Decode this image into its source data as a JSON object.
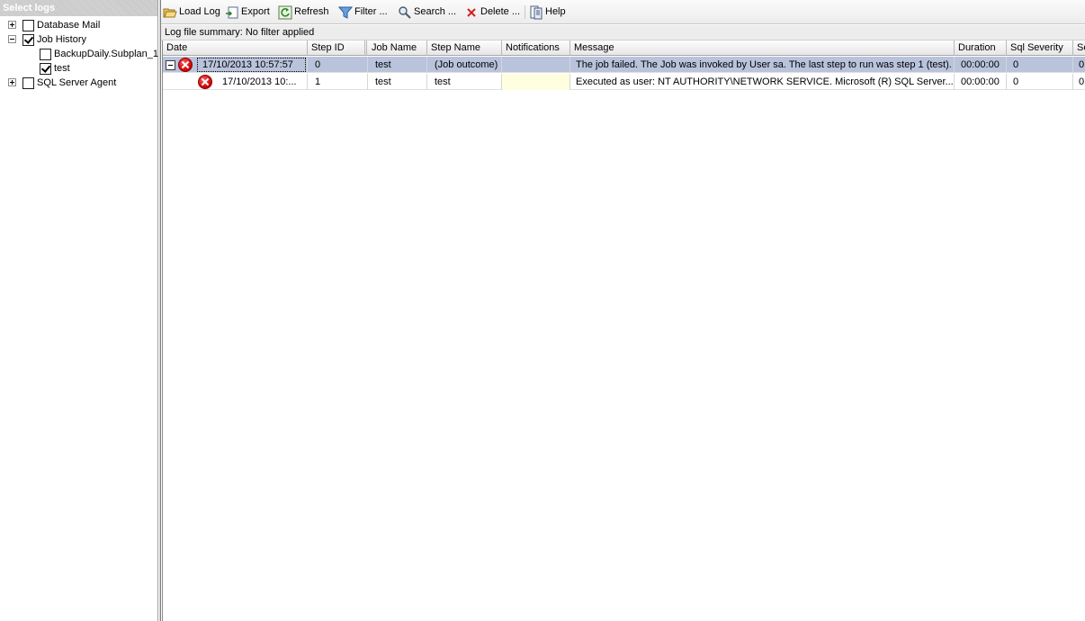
{
  "left_pane": {
    "title": "Select logs",
    "tree": [
      {
        "label": "Database Mail",
        "expanded": false,
        "checked": false,
        "level": 0
      },
      {
        "label": "Job History",
        "expanded": true,
        "checked": true,
        "level": 0
      },
      {
        "label": "BackupDaily.Subplan_1",
        "checked": false,
        "level": 1
      },
      {
        "label": "test",
        "checked": true,
        "level": 1
      },
      {
        "label": "SQL Server Agent",
        "expanded": false,
        "checked": false,
        "level": 0
      }
    ]
  },
  "toolbar": {
    "load_log": "Load Log",
    "export": "Export",
    "refresh": "Refresh",
    "filter": "Filter ...",
    "search": "Search ...",
    "delete": "Delete ...",
    "help": "Help"
  },
  "summary": "Log file summary: No filter applied",
  "grid": {
    "columns": [
      "Date",
      "Step ID",
      "Job Name",
      "Step Name",
      "Notifications",
      "Message",
      "Duration",
      "Sql Severity",
      "Se"
    ],
    "rows": [
      {
        "expanded": true,
        "selected": true,
        "status": "error",
        "date": "17/10/2013 10:57:57",
        "step_id": "0",
        "job_name": "test",
        "step_name": "(Job outcome)",
        "notifications": "",
        "message": "The job failed.  The Job was invoked by User sa.  The last step to run was step 1 (test).",
        "duration": "00:00:00",
        "sql_severity": "0",
        "extra": "0"
      },
      {
        "expanded": false,
        "selected": false,
        "status": "error",
        "date": "17/10/2013 10:...",
        "step_id": "1",
        "job_name": "test",
        "step_name": "test",
        "notifications": "",
        "message": "Executed as user: NT AUTHORITY\\NETWORK SERVICE. Microsoft (R) SQL Server...",
        "duration": "00:00:00",
        "sql_severity": "0",
        "extra": "0"
      }
    ]
  },
  "colors": {
    "selected_row": "#b9c3dc",
    "notification_highlight": "#ffffe0",
    "error_icon": "#c80000"
  }
}
